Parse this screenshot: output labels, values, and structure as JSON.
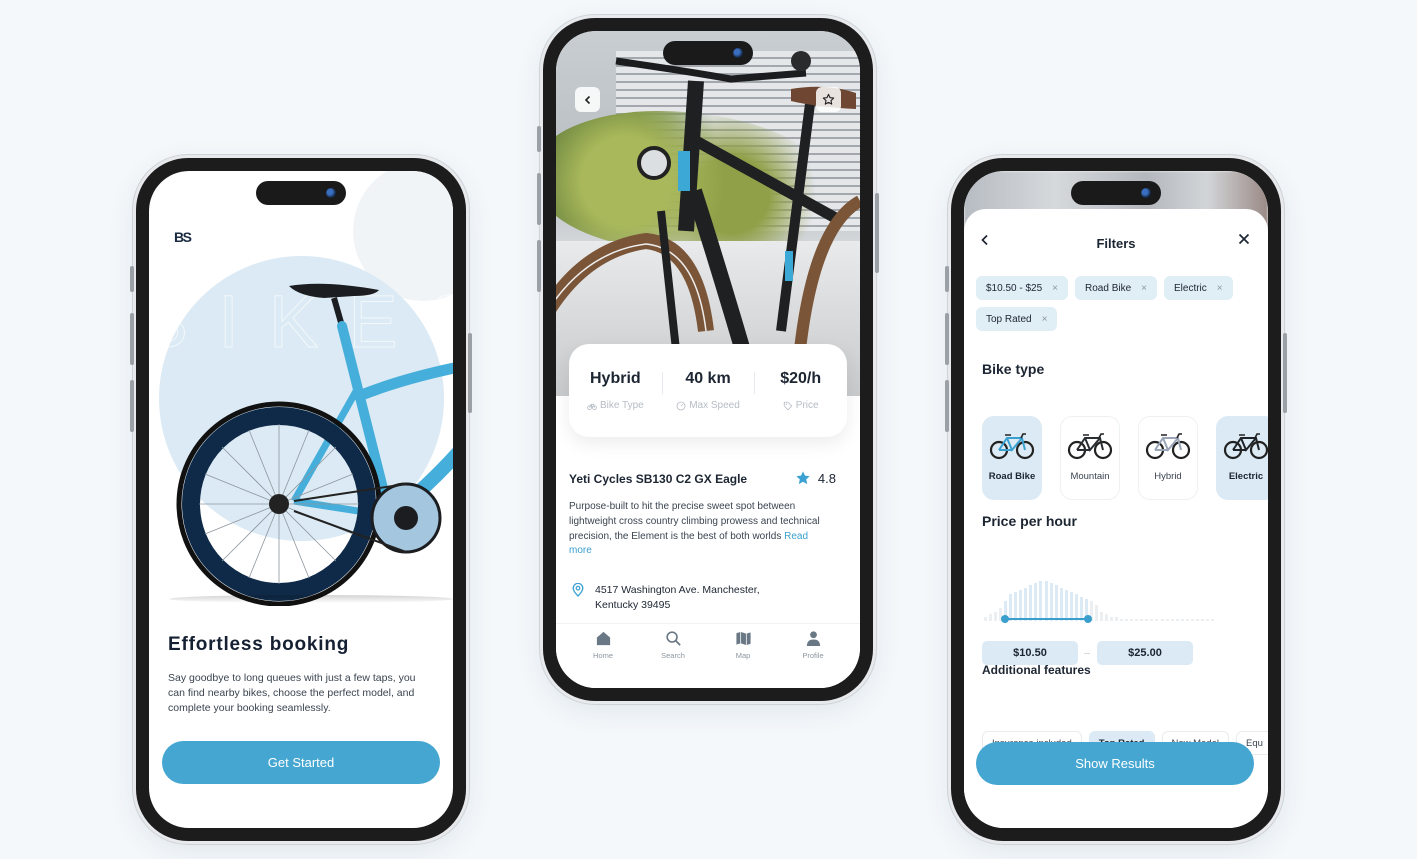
{
  "colors": {
    "accent": "#44a6d1",
    "chip_bg": "#e0eef6",
    "page_bg": "#f4f8fb",
    "dark_text": "#1c2532"
  },
  "onboarding": {
    "logo": "BS",
    "watermark": "BIKESH",
    "title": "Effortless booking",
    "description": "Say goodbye to long queues with just a few taps, you can find nearby bikes, choose the perfect model, and complete your booking seamlessly.",
    "cta_label": "Get Started"
  },
  "detail": {
    "back_icon": "chevron-left-icon",
    "favorite_icon": "star-outline-icon",
    "stats": [
      {
        "value": "Hybrid",
        "label": "Bike Type",
        "icon": "bike-icon"
      },
      {
        "value": "40 km",
        "label": "Max Speed",
        "icon": "speedometer-icon"
      },
      {
        "value": "$20/h",
        "label": "Price",
        "icon": "tag-icon"
      }
    ],
    "name": "Yeti Cycles SB130 C2 GX Eagle",
    "rating": "4.8",
    "description": "Purpose-built to hit the precise sweet spot between lightweight cross country climbing prowess and technical precision, the Element is the best of both worlds",
    "read_more": "Read more",
    "address_line1": "4517 Washington Ave. Manchester,",
    "address_line2": "Kentucky 39495",
    "tabs": [
      {
        "label": "Home",
        "icon": "home-icon"
      },
      {
        "label": "Search",
        "icon": "search-icon"
      },
      {
        "label": "Map",
        "icon": "map-icon"
      },
      {
        "label": "Profile",
        "icon": "profile-icon"
      }
    ]
  },
  "filters": {
    "title": "Filters",
    "active_chips": [
      "$10.50 - $25",
      "Road Bike",
      "Electric",
      "Top Rated"
    ],
    "chip_remove_glyph": "×",
    "bike_type_title": "Bike type",
    "bike_types": [
      {
        "label": "Road Bike",
        "selected": true,
        "color": "#3aa0d0"
      },
      {
        "label": "Mountain",
        "selected": false,
        "color": "#2a2d31"
      },
      {
        "label": "Hybrid",
        "selected": false,
        "color": "#9aa5b8"
      },
      {
        "label": "Electric",
        "selected": true,
        "color": "#1f2226"
      }
    ],
    "price_title": "Price per hour",
    "price_min": "$10.50",
    "price_max": "$25.00",
    "price_range_fraction": [
      0.09,
      0.45
    ],
    "price_histogram": [
      2,
      3,
      4,
      6,
      9,
      12,
      13,
      14,
      15,
      16,
      17,
      18,
      18,
      17,
      16,
      15,
      14,
      13,
      12,
      11,
      10,
      9,
      7,
      4,
      3,
      2,
      2,
      1,
      1,
      1,
      1,
      1,
      1,
      1,
      1,
      1,
      1,
      1,
      1,
      1,
      1,
      1,
      1,
      1,
      1,
      1
    ],
    "features_title": "Additional features",
    "features": [
      {
        "label": "Insurance included",
        "selected": false
      },
      {
        "label": "Top Rated",
        "selected": true
      },
      {
        "label": "New Model",
        "selected": false
      },
      {
        "label": "Equ",
        "selected": false
      }
    ],
    "cta_label": "Show Results"
  }
}
